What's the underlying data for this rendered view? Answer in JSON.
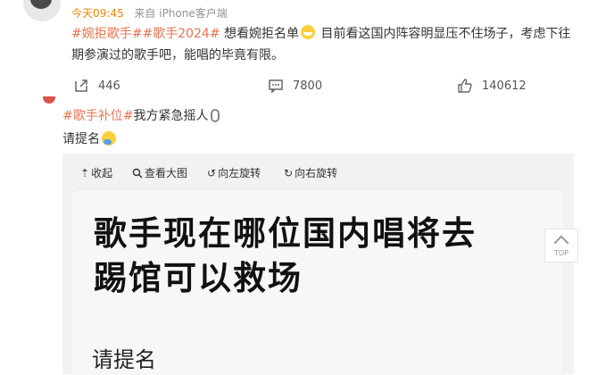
{
  "post": {
    "time": "今天09:45",
    "source": "来自 iPhone客户端",
    "tag1": "#婉拒歌手#",
    "tag2": "#歌手2024#",
    "text_a": "想看婉拒名单",
    "text_b": "目前看这国内阵容明显压不住场子，考虑下往期参演过的歌手吧，能唱的毕竟有限。",
    "emoji": "grin-emoji"
  },
  "actions": {
    "reposts": "446",
    "comments": "7800",
    "likes": "140612"
  },
  "repost": {
    "tag": "#歌手补位#",
    "text": "我方紧急摇人",
    "line2": "请提名"
  },
  "viewer": {
    "toolbar": {
      "collapse": "收起",
      "view_large": "查看大图",
      "rotate_left": "向左旋转",
      "rotate_right": "向右旋转"
    },
    "headline_line1": "歌手现在哪位国内唱将去",
    "headline_line2": "踢馆可以救场",
    "ask": "请提名"
  },
  "back_to_top": {
    "label": "TOP"
  },
  "colors": {
    "tag": "#eb7350",
    "time": "#ff8200",
    "meta": "#939393"
  }
}
